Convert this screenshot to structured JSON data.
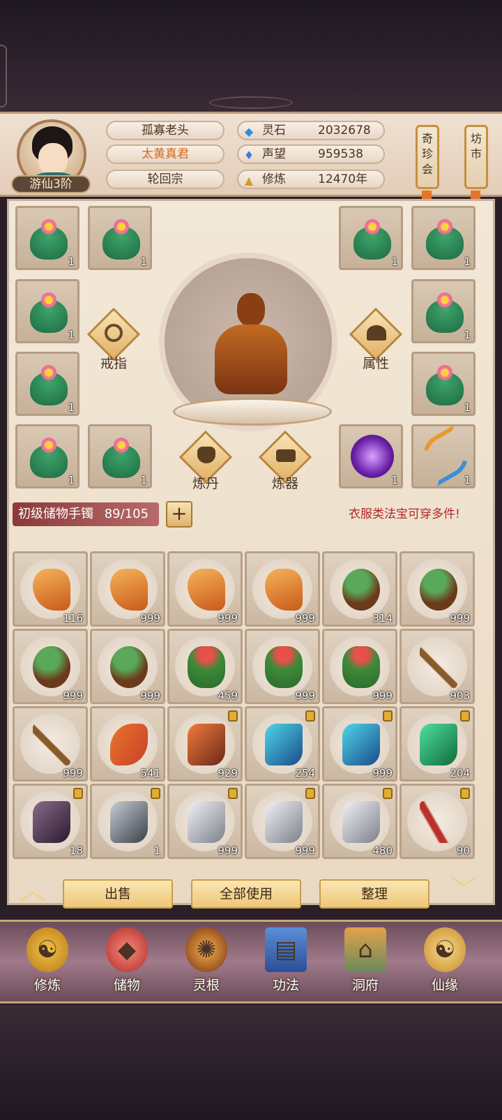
{
  "player": {
    "name": "孤寡老头",
    "title": "太黄真君",
    "sect": "轮回宗",
    "rank": "游仙3阶"
  },
  "resources": [
    {
      "icon": "spirit-stone-icon",
      "label": "灵石",
      "value": "2032678"
    },
    {
      "icon": "reputation-crystal-icon",
      "label": "声望",
      "value": "959538"
    },
    {
      "icon": "meditation-icon",
      "label": "修炼",
      "value": "12470年"
    }
  ],
  "shops": {
    "treasure": "奇珍会",
    "market": "坊市"
  },
  "equipment_slots": [
    {
      "item": "green-plant-icon",
      "count": "1"
    },
    {
      "item": "green-plant-icon",
      "count": "1"
    },
    {
      "item": "green-plant-icon",
      "count": "1"
    },
    {
      "item": "green-plant-icon",
      "count": "1"
    },
    {
      "item": "green-plant-icon",
      "count": "1"
    },
    {
      "item": "green-plant-icon",
      "count": "1"
    },
    {
      "item": "green-plant-icon",
      "count": "1"
    },
    {
      "item": "green-plant-icon",
      "count": "1"
    },
    {
      "item": "green-plant-icon",
      "count": "1"
    },
    {
      "item": "green-plant-icon",
      "count": "1"
    },
    {
      "item": "purple-dragon-orb-icon",
      "count": "1"
    },
    {
      "item": "golden-bow-icon",
      "count": "1"
    }
  ],
  "actions": {
    "ring": "戒指",
    "attribute": "属性",
    "alchemy": "炼丹",
    "forge": "炼器"
  },
  "bag": {
    "name": "初级储物手镯",
    "capacity": "89/105",
    "hint": "衣服类法宝可穿多件!"
  },
  "inventory": [
    {
      "item": "ginseng-root-icon",
      "count": "116",
      "locked": false
    },
    {
      "item": "ginseng-root-icon",
      "count": "999",
      "locked": false
    },
    {
      "item": "ginseng-root-icon",
      "count": "999",
      "locked": false
    },
    {
      "item": "ginseng-root-icon",
      "count": "999",
      "locked": false
    },
    {
      "item": "leafy-root-icon",
      "count": "314",
      "locked": false
    },
    {
      "item": "leafy-root-icon",
      "count": "999",
      "locked": false
    },
    {
      "item": "leafy-root-icon",
      "count": "999",
      "locked": false
    },
    {
      "item": "leafy-root-icon",
      "count": "999",
      "locked": false
    },
    {
      "item": "red-flower-herb-icon",
      "count": "459",
      "locked": false
    },
    {
      "item": "red-flower-herb-icon",
      "count": "999",
      "locked": false
    },
    {
      "item": "red-flower-herb-icon",
      "count": "999",
      "locked": false
    },
    {
      "item": "berry-branch-icon",
      "count": "903",
      "locked": false
    },
    {
      "item": "berry-branch-icon",
      "count": "999",
      "locked": false
    },
    {
      "item": "cordyceps-icon",
      "count": "541",
      "locked": false
    },
    {
      "item": "red-ore-icon",
      "count": "929",
      "locked": true
    },
    {
      "item": "blue-ore-icon",
      "count": "254",
      "locked": true
    },
    {
      "item": "blue-ore-icon",
      "count": "999",
      "locked": true
    },
    {
      "item": "green-ore-icon",
      "count": "204",
      "locked": true
    },
    {
      "item": "dark-purple-ore-icon",
      "count": "18",
      "locked": true
    },
    {
      "item": "grey-ore-icon",
      "count": "1",
      "locked": true
    },
    {
      "item": "silver-ore-icon",
      "count": "999",
      "locked": true
    },
    {
      "item": "silver-ore-icon",
      "count": "999",
      "locked": true
    },
    {
      "item": "silver-ore-icon",
      "count": "480",
      "locked": true
    },
    {
      "item": "red-coral-branch-icon",
      "count": "90",
      "locked": true
    }
  ],
  "buttons": {
    "sell": "出售",
    "use_all": "全部使用",
    "sort": "整理"
  },
  "nav": [
    {
      "icon": "cultivate-icon",
      "label": "修炼"
    },
    {
      "icon": "storage-bag-icon",
      "label": "储物"
    },
    {
      "icon": "spirit-root-icon",
      "label": "灵根"
    },
    {
      "icon": "technique-book-icon",
      "label": "功法"
    },
    {
      "icon": "cave-mansion-icon",
      "label": "洞府"
    },
    {
      "icon": "fate-gourd-icon",
      "label": "仙缘"
    }
  ],
  "colors": {
    "accent": "#c78f3c",
    "title_orange": "#d2691e",
    "hint_red": "#b3262a"
  }
}
